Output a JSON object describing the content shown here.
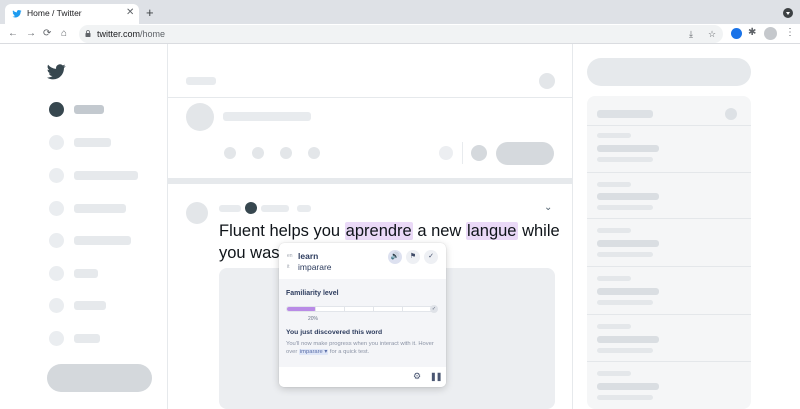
{
  "browser": {
    "tab_title": "Home / Twitter",
    "tab_close": "✕",
    "new_tab": "+",
    "url_host": "twitter.com",
    "url_path": "/home",
    "nav": {
      "back": "←",
      "forward": "→",
      "reload": "⟳",
      "home": "⌂"
    },
    "icons": [
      "favicon-twitter",
      "lock-icon",
      "install-icon",
      "star-icon",
      "extension-icon",
      "puzzle-icon",
      "profile-avatar",
      "kebab-menu-icon"
    ]
  },
  "tweet": {
    "segments": [
      {
        "text": "Fluent helps you ",
        "highlight": false
      },
      {
        "text": "aprendre",
        "highlight": true
      },
      {
        "text": " a new ",
        "highlight": false
      },
      {
        "text": "langue",
        "highlight": true
      },
      {
        "text": " while you waste tim",
        "highlight": false
      }
    ]
  },
  "popup": {
    "source_lang": "en",
    "source_word": "learn",
    "target_lang": "it",
    "target_word": "imparare",
    "familiarity_label": "Familiarity level",
    "familiarity_percent": "20%",
    "familiarity_fraction": 0.2,
    "discover_title": "You just discovered this word",
    "discover_body_before": "You'll now make progress when you interact with it. Hover over ",
    "discover_body_word": "imparare",
    "discover_body_after": " for a quick test.",
    "icons": {
      "speaker": "🔊",
      "flag": "⚑",
      "check": "✓",
      "settings": "⚙",
      "pause": "❚❚"
    }
  },
  "colors": {
    "highlight": "#ead9f7",
    "progress_fill": "#b98be6",
    "twitter_blue": "#1d9bf0"
  }
}
